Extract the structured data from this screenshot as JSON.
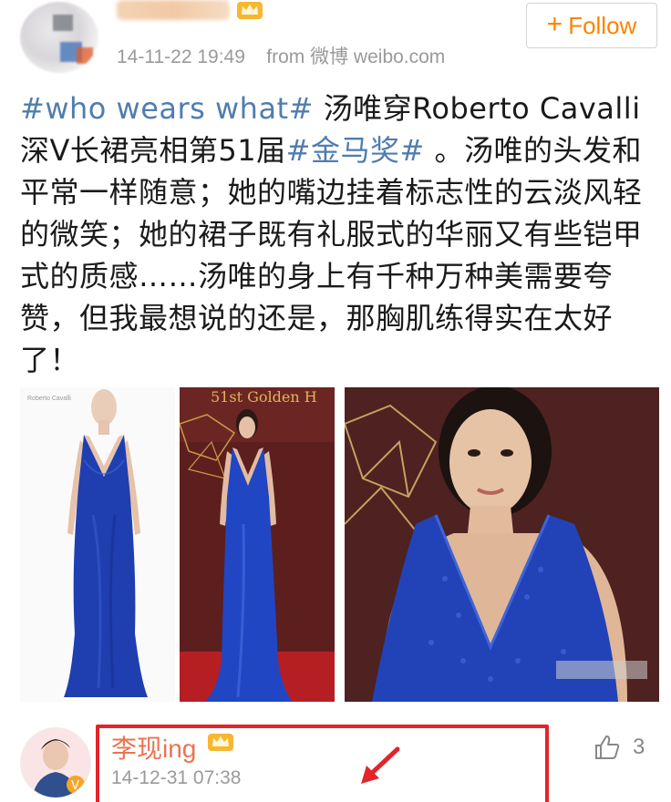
{
  "post": {
    "timestamp": "14-11-22 19:49",
    "source_prefix": "from",
    "source": "微博 weibo.com",
    "follow_label": "Follow",
    "text_segments": [
      {
        "type": "hashtag",
        "text": "#who wears what#"
      },
      {
        "type": "text",
        "text": " 汤唯穿Roberto Cavalli深V长裙亮相第51届"
      },
      {
        "type": "hashtag",
        "text": "#金马奖#"
      },
      {
        "type": "text",
        "text": " 。汤唯的头发和平常一样随意；她的嘴边挂着标志性的云淡风轻的微笑；她的裙子既有礼服式的华丽又有些铠甲式的质感……汤唯的身上有千种万种美需要夸赞，但我最想说的还是，那胸肌练得实在太好了！"
      }
    ],
    "images": [
      {
        "name": "dress-product-photo",
        "watermark": "Roberto Cavalli"
      },
      {
        "name": "red-carpet-photo",
        "sign_text": "51st Golden H"
      },
      {
        "name": "closeup-photo"
      }
    ]
  },
  "comment": {
    "username": "李现ing",
    "timestamp": "14-12-31 07:38",
    "like_count": "3"
  },
  "colors": {
    "hashtag": "#507daf",
    "follow": "#ff8200",
    "comment_name": "#eb7350",
    "highlight": "#e3242b",
    "dress_blue": "#1f3fb0"
  },
  "icons": [
    "vip-crown-icon",
    "plus-icon",
    "thumbs-up-icon",
    "red-arrow-icon",
    "verified-badge-icon"
  ]
}
